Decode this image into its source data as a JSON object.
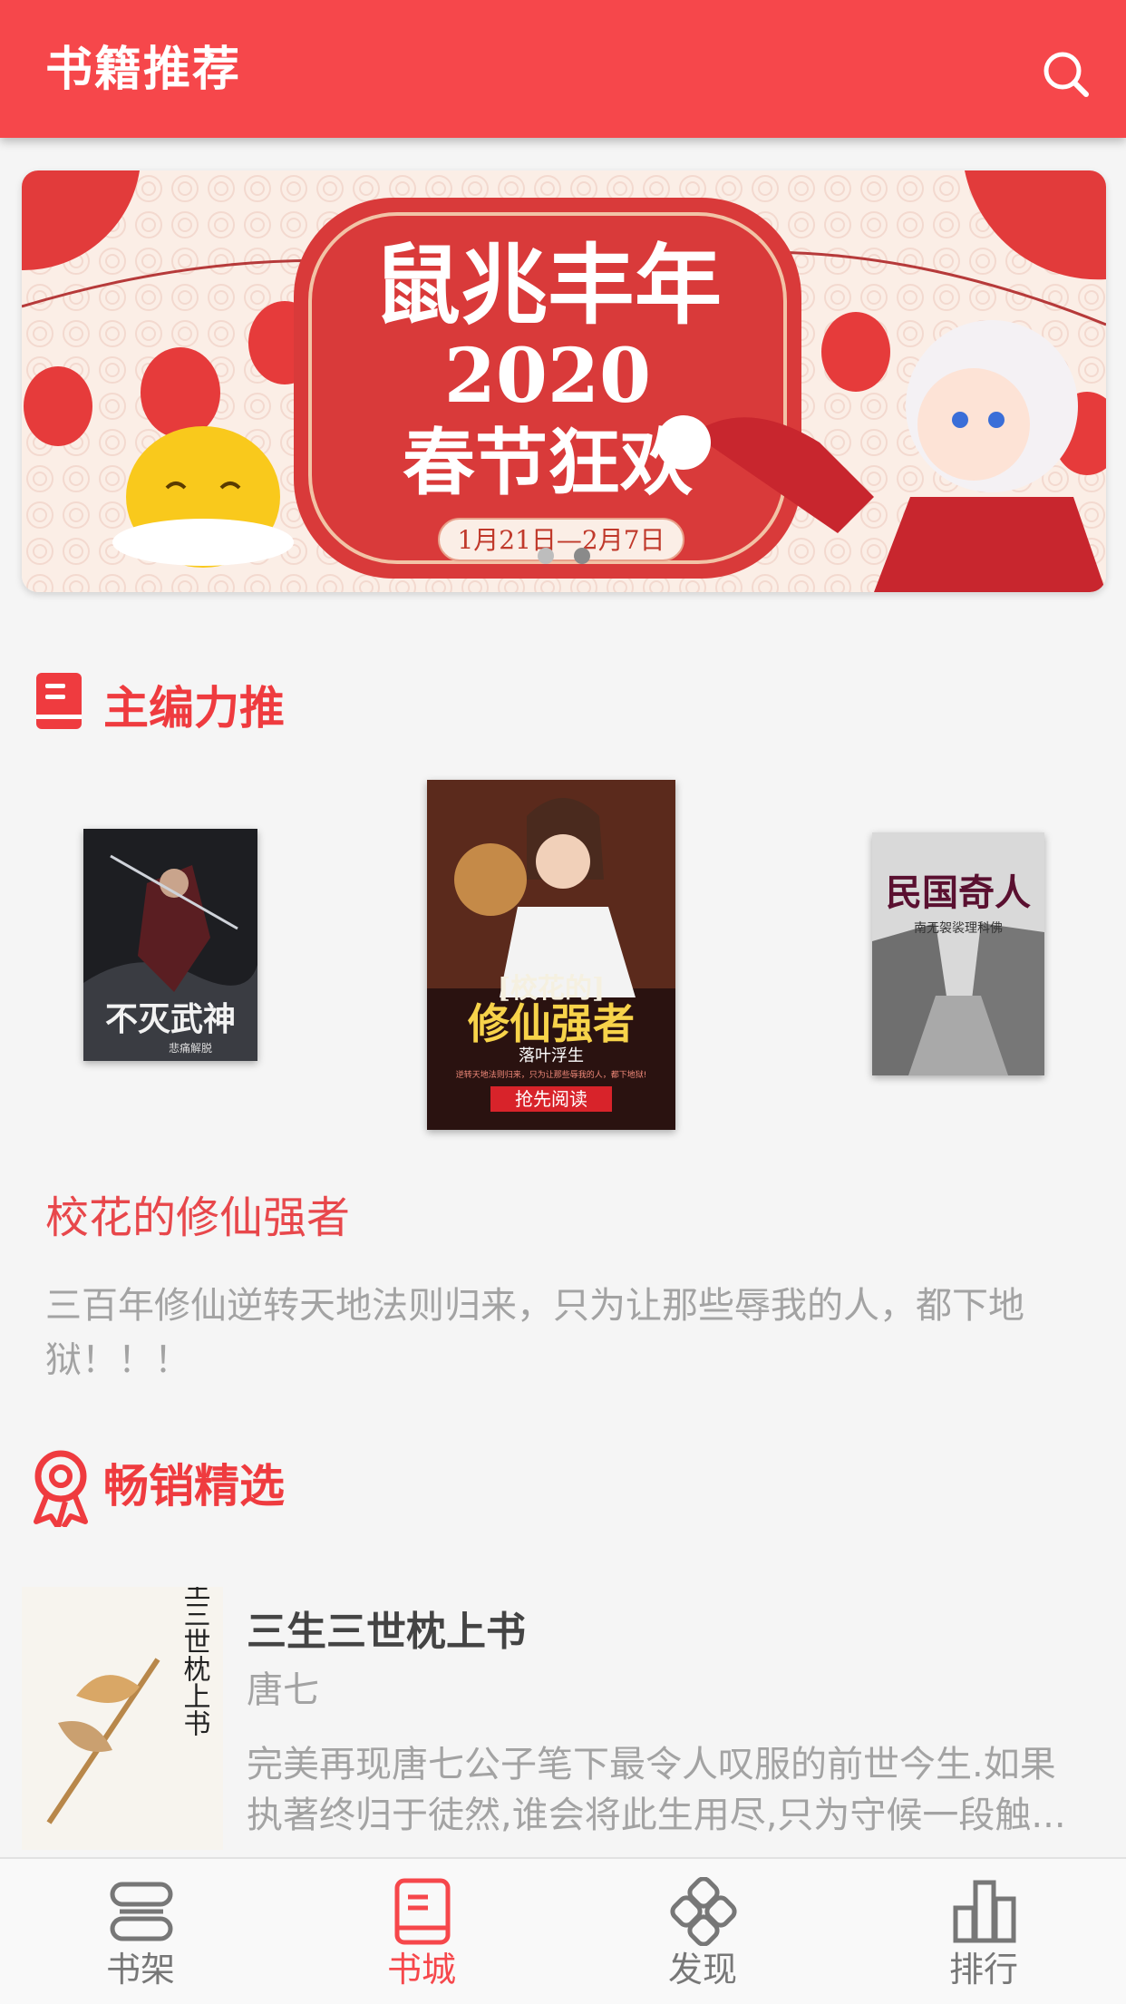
{
  "header": {
    "title": "书籍推荐",
    "search_icon": "search-icon"
  },
  "banner": {
    "headline": "鼠兆丰年",
    "year": "2020",
    "subtitle": "春节狂欢",
    "dates": "1月21日—2月7日",
    "dots_count": 2,
    "active_dot": 1
  },
  "featured": {
    "section_title": "主编力推",
    "section_icon": "book-icon",
    "covers": [
      {
        "title": "不灭武神",
        "author": "悲痛解脱"
      },
      {
        "title": "[校花的]修仙强者",
        "author": "落叶浮生",
        "tagline": "逆转天地法则归来，只为让那些辱我的人，都下地狱!",
        "cta": "抢先阅读"
      },
      {
        "title": "民国奇人",
        "author": "南无袈裟理科佛"
      }
    ],
    "selected_title": "校花的修仙强者",
    "selected_desc": "三百年修仙逆转天地法则归来，只为让那些辱我的人，都下地狱！！！"
  },
  "bestsellers": {
    "section_title": "畅销精选",
    "section_icon": "ribbon-award-icon",
    "items": [
      {
        "title": "三生三世枕上书",
        "cover_title": "三生三世枕上书",
        "author": "唐七",
        "desc": "完美再现唐七公子笔下最令人叹服的前世今生.如果执著终归于徒然,谁会将此生用尽,只为守候一段触..."
      }
    ]
  },
  "tabs": [
    {
      "label": "书架",
      "icon": "bookshelf-icon",
      "active": false
    },
    {
      "label": "书城",
      "icon": "bookstore-icon",
      "active": true
    },
    {
      "label": "发现",
      "icon": "discover-icon",
      "active": false
    },
    {
      "label": "排行",
      "icon": "ranking-icon",
      "active": false
    }
  ],
  "colors": {
    "brand": "#f6474b",
    "accent_text": "#ef3b3f",
    "muted": "#a3a3a3"
  }
}
